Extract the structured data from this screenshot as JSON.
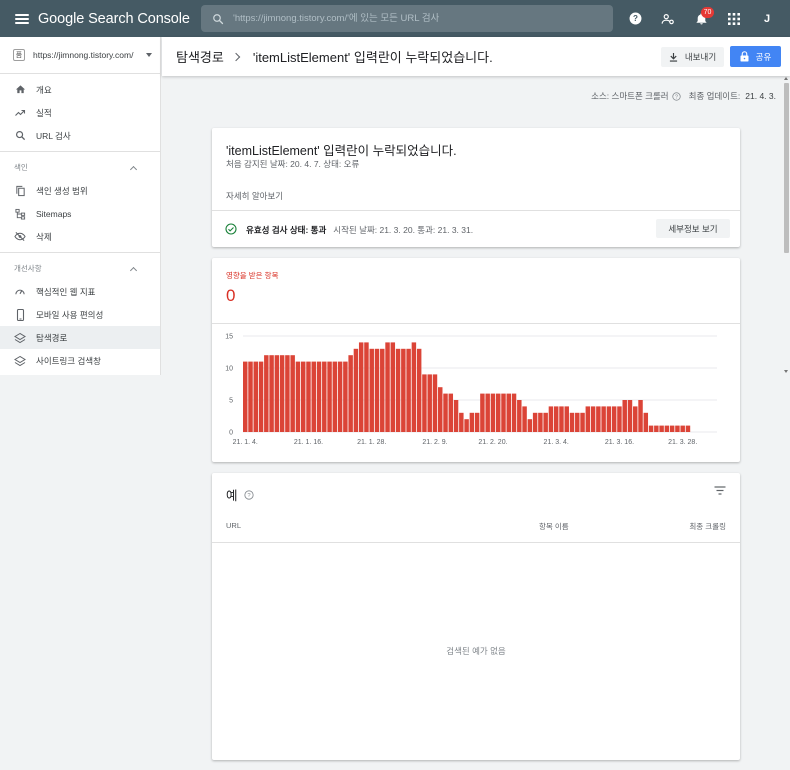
{
  "appbar": {
    "brand": "Google Search Console",
    "search_placeholder": "'https://jimnong.tistory.com/'에 있는 모든 URL 검사",
    "notification_count": "70",
    "avatar_letter": "J"
  },
  "sidebar": {
    "property": "https://jimnong.tistory.com/",
    "property_icon": "품",
    "items_top": [
      {
        "label": "개요",
        "icon": "home-icon"
      },
      {
        "label": "실적",
        "icon": "trending-icon"
      },
      {
        "label": "URL 검사",
        "icon": "search-icon"
      }
    ],
    "section_index": {
      "label": "색인",
      "items": [
        {
          "label": "색인 생성 범위",
          "icon": "copy-icon"
        },
        {
          "label": "Sitemaps",
          "icon": "sitemap-icon"
        },
        {
          "label": "삭제",
          "icon": "eye-off-icon"
        }
      ]
    },
    "section_enhance": {
      "label": "개선사항",
      "items": [
        {
          "label": "핵심적인 웹 지표",
          "icon": "speed-icon"
        },
        {
          "label": "모바일 사용 편의성",
          "icon": "phone-icon"
        },
        {
          "label": "탐색경로",
          "icon": "layers-icon"
        },
        {
          "label": "사이트링크 검색창",
          "icon": "layers-icon"
        }
      ]
    }
  },
  "header": {
    "breadcrumb_parent": "탐색경로",
    "breadcrumb_current": "'itemListElement' 입력란이 누락되었습니다.",
    "export_label": "내보내기",
    "share_label": "공유"
  },
  "meta": {
    "source_label": "소스: 스마트폰 크롤러",
    "updated_label": "최종 업데이트:",
    "updated_value": "21. 4. 3."
  },
  "issue_card": {
    "title": "'itemListElement' 입력란이 누락되었습니다.",
    "subtitle": "처음 감지된 날짜: 20. 4. 7.   상태: 오류",
    "learn_more": "자세히 알아보기",
    "validation_label": "유효성 검사 상태: 통과",
    "validation_meta": "시작된 날짜: 21. 3. 20.   통과: 21. 3. 31.",
    "details_button": "세부정보 보기",
    "colors": {
      "pass": "#188038"
    }
  },
  "affected_card": {
    "label": "영향을 받은 항목",
    "value": "0",
    "color": "#d93025"
  },
  "chart_data": {
    "type": "bar",
    "ylim": [
      0,
      15
    ],
    "yticks": [
      0,
      5,
      10,
      15
    ],
    "xtick_labels": [
      "21. 1. 4.",
      "21. 1. 16.",
      "21. 1. 28.",
      "21. 2. 9.",
      "21. 2. 20.",
      "21. 3. 4.",
      "21. 3. 16.",
      "21. 3. 28."
    ],
    "xtick_index": [
      0,
      12,
      24,
      36,
      47,
      59,
      71,
      83
    ],
    "color": "#db4437",
    "values": [
      11,
      11,
      11,
      11,
      12,
      12,
      12,
      12,
      12,
      12,
      11,
      11,
      11,
      11,
      11,
      11,
      11,
      11,
      11,
      11,
      12,
      13,
      14,
      14,
      13,
      13,
      13,
      14,
      14,
      13,
      13,
      13,
      14,
      13,
      9,
      9,
      9,
      7,
      6,
      6,
      5,
      3,
      2,
      3,
      3,
      6,
      6,
      6,
      6,
      6,
      6,
      6,
      5,
      4,
      2,
      3,
      3,
      3,
      4,
      4,
      4,
      4,
      3,
      3,
      3,
      4,
      4,
      4,
      4,
      4,
      4,
      4,
      5,
      5,
      4,
      5,
      3,
      1,
      1,
      1,
      1,
      1,
      1,
      1,
      1
    ]
  },
  "examples_card": {
    "title": "예",
    "columns": [
      "URL",
      "항목 이름",
      "최종 크롤링"
    ],
    "empty_text": "검색된 예가 없음"
  }
}
